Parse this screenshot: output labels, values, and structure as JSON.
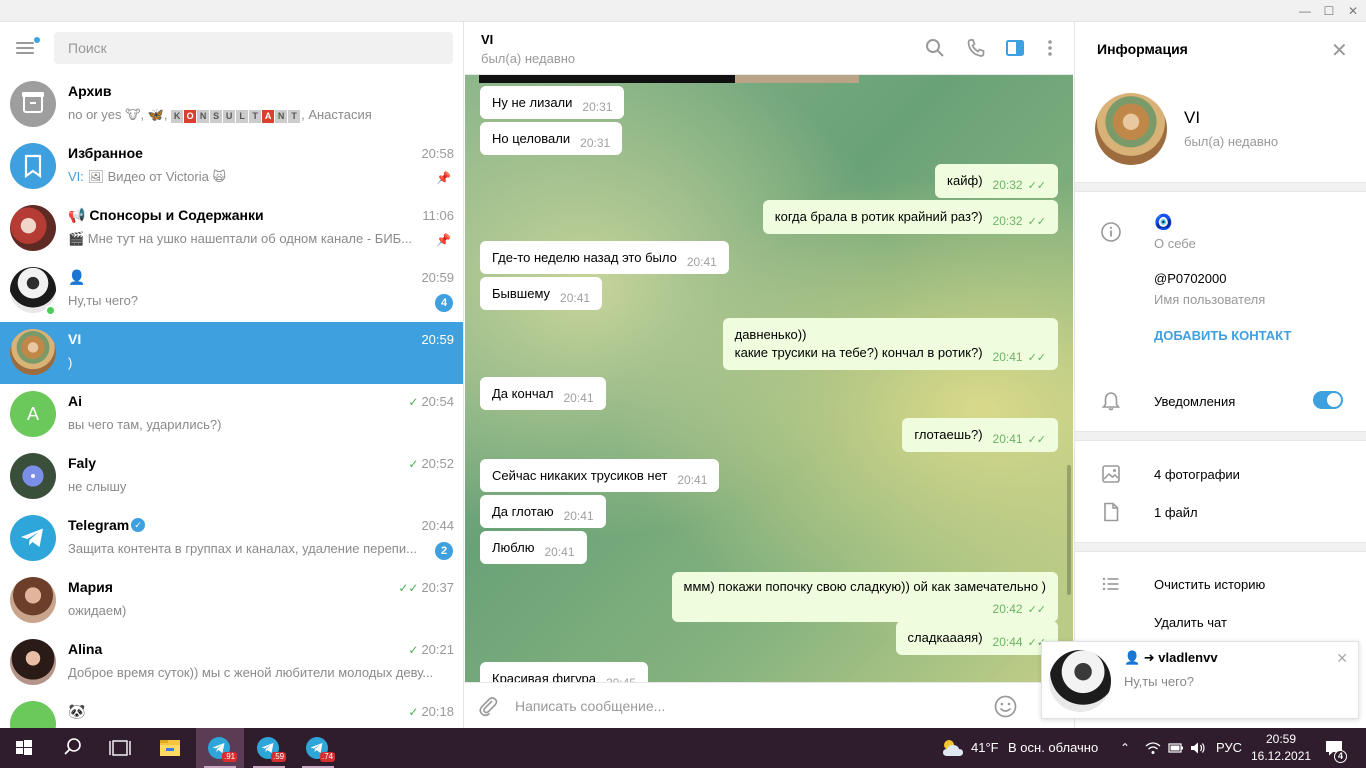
{
  "search": {
    "placeholder": "Поиск"
  },
  "chats": [
    {
      "name": "Архив",
      "preview_parts": [
        "no or yes 🐮, 🦋, ",
        "",
        ", Анастасия"
      ],
      "konsult": [
        "K",
        "O",
        "N",
        "S",
        "U",
        "L",
        "T",
        "A",
        "N",
        "T"
      ],
      "konsult_red": [
        1,
        7
      ],
      "time": "",
      "avatar": "archive"
    },
    {
      "name": "Избранное",
      "sender": "VI:",
      "preview": " 🖼 Видео от Victoria 🙀",
      "time": "20:58",
      "pinned": true,
      "avatar": "saved"
    },
    {
      "name": "📢 Спонсоры и Содержанки",
      "preview": "🎬 Мне тут на ушко нашептали об одном канале -  БИБ...",
      "time": "11:06",
      "pinned": true,
      "avatar": "photo-red"
    },
    {
      "name": "👤",
      "preview": "Ну,ты чего?",
      "time": "20:59",
      "badge": "4",
      "online": true,
      "avatar": "photo-dark"
    },
    {
      "name": "VI",
      "preview": ")",
      "time": "20:59",
      "active": true,
      "avatar": "painting"
    },
    {
      "name": "Ai",
      "preview": "вы чего там, ударились?)",
      "time": "20:54",
      "check": "✓",
      "avatar": "letter-A"
    },
    {
      "name": "Faly",
      "preview": "не слышу",
      "time": "20:52",
      "check": "✓",
      "avatar": "flower"
    },
    {
      "name": "Telegram",
      "preview": "Защита контента в группах и каналах, удаление перепи...",
      "time": "20:44",
      "badge": "2",
      "verified": true,
      "avatar": "telegram"
    },
    {
      "name": "Мария",
      "preview": "ожидаем)",
      "time": "20:37",
      "check": "✓✓",
      "avatar": "photo-girl1"
    },
    {
      "name": "Alina",
      "preview": "Доброе время суток)) мы с женой любители молодых деву...",
      "time": "20:21",
      "check": "✓",
      "avatar": "photo-girl2"
    },
    {
      "name": "🐼",
      "preview": "",
      "time": "20:18",
      "check": "✓",
      "avatar": "green"
    }
  ],
  "header": {
    "title": "VI",
    "status": "был(а) недавно"
  },
  "messages": [
    {
      "dir": "in",
      "text": "Ну не лизали",
      "time": "20:31"
    },
    {
      "dir": "in",
      "text": "Но целовали",
      "time": "20:31"
    },
    {
      "dir": "out",
      "text": "кайф)",
      "time": "20:32"
    },
    {
      "dir": "out",
      "text": "когда брала в ротик крайний раз?)",
      "time": "20:32"
    },
    {
      "dir": "in",
      "text": "Где-то неделю назад это было",
      "time": "20:41"
    },
    {
      "dir": "in",
      "text": "Бывшему",
      "time": "20:41"
    },
    {
      "dir": "out",
      "text": "давненько))",
      "text2": "какие трусики на тебе?) кончал в ротик?)",
      "time": "20:41"
    },
    {
      "dir": "in",
      "text": "Да кончал",
      "time": "20:41"
    },
    {
      "dir": "out",
      "text": "глотаешь?)",
      "time": "20:41"
    },
    {
      "dir": "in",
      "text": "Сейчас никаких трусиков нет",
      "time": "20:41"
    },
    {
      "dir": "in",
      "text": "Да глотаю",
      "time": "20:41"
    },
    {
      "dir": "in",
      "text": "Люблю",
      "time": "20:41"
    },
    {
      "dir": "out",
      "text": "ммм) покажи попочку свою сладкую)) ой как замечательно )",
      "time": "20:42"
    },
    {
      "dir": "out",
      "text": "сладкаааяя)",
      "time": "20:44"
    },
    {
      "dir": "in",
      "text": "Красивая фигура",
      "time": "20:45"
    }
  ],
  "composer": {
    "placeholder": "Написать сообщение..."
  },
  "info": {
    "header": "Информация",
    "name": "VI",
    "status": "был(а) недавно",
    "about_emoji": "🧿",
    "about_label": "О себе",
    "username": "@P0702000",
    "username_label": "Имя пользователя",
    "add_contact": "ДОБАВИТЬ КОНТАКТ",
    "notifications": "Уведомления",
    "notifications_on": true,
    "photos": "4 фотографии",
    "files": "1 файл",
    "clear_history": "Очистить историю",
    "delete_chat": "Удалить чат"
  },
  "notification": {
    "title": "👤 ➜ vladlenvv",
    "text": "Ну,ты чего?"
  },
  "taskbar": {
    "badges": [
      ".91",
      ".59",
      ".74"
    ],
    "temp": "41°F",
    "weather": "В осн. облачно",
    "lang": "РУС",
    "time": "20:59",
    "date": "16.12.2021",
    "notif_count": "4"
  },
  "colors": {
    "accent": "#3ea0de",
    "online": "#4bcb5a",
    "out_bubble": "#effdde",
    "taskbar": "#2f1d2d"
  }
}
